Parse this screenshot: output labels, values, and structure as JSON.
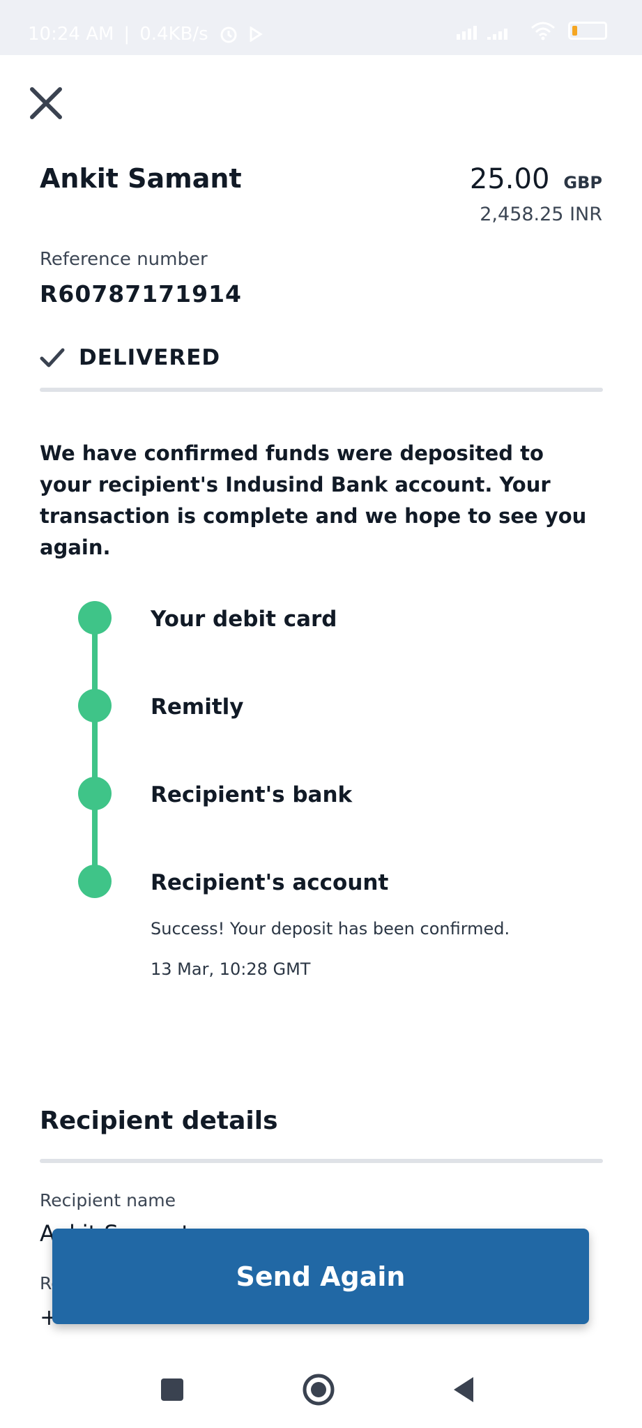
{
  "status_bar": {
    "time": "10:24 AM",
    "speed": "0.4KB/s",
    "alarm_icon": "alarm-icon",
    "play_icon": "play-icon",
    "signal_icon": "signal-icon",
    "wifi_icon": "wifi-icon",
    "battery_icon": "battery-icon",
    "battery_level": 0.15,
    "battery_color": "#f5a623"
  },
  "header": {
    "close_icon": "close-icon"
  },
  "transfer": {
    "recipient_name": "Ankit Samant",
    "amount": "25.00",
    "currency": "GBP",
    "converted_amount": "2,458.25 INR"
  },
  "reference": {
    "label": "Reference number",
    "value": "R60787171914"
  },
  "status": {
    "icon": "check-icon",
    "text": "DELIVERED"
  },
  "message": "We have confirmed funds were deposited to your recipient's Indusind Bank account. Your transaction is complete and we hope to see you again.",
  "timeline": {
    "color": "#3fc488",
    "steps": [
      {
        "label": "Your debit card"
      },
      {
        "label": "Remitly"
      },
      {
        "label": "Recipient's bank"
      },
      {
        "label": "Recipient's account",
        "note": "Success! Your deposit has been confirmed.",
        "timestamp": "13 Mar, 10:28 GMT"
      }
    ]
  },
  "recipient_details": {
    "title": "Recipient details",
    "name_label": "Recipient name",
    "name_value": "Ankit Samant",
    "next_label": "Re",
    "next_value": "+"
  },
  "actions": {
    "send_again_label": "Send Again",
    "button_color": "#2168a5"
  },
  "nav_bar": {
    "recents_icon": "square-icon",
    "home_icon": "circle-icon",
    "back_icon": "triangle-back-icon"
  }
}
